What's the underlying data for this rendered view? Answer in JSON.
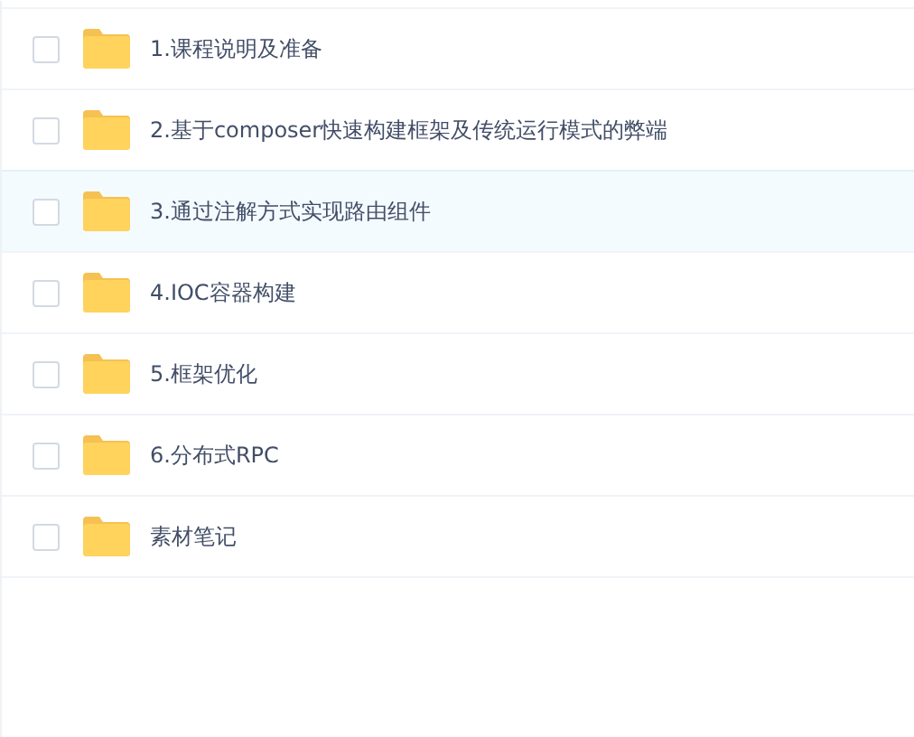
{
  "files": [
    {
      "name": "1.课程说明及准备",
      "checked": false,
      "highlighted": false
    },
    {
      "name": "2.基于composer快速构建框架及传统运行模式的弊端",
      "checked": false,
      "highlighted": false
    },
    {
      "name": "3.通过注解方式实现路由组件",
      "checked": false,
      "highlighted": true
    },
    {
      "name": "4.IOC容器构建",
      "checked": false,
      "highlighted": false
    },
    {
      "name": "5.框架优化",
      "checked": false,
      "highlighted": false
    },
    {
      "name": "6.分布式RPC",
      "checked": false,
      "highlighted": false
    },
    {
      "name": "素材笔记",
      "checked": false,
      "highlighted": false
    }
  ]
}
